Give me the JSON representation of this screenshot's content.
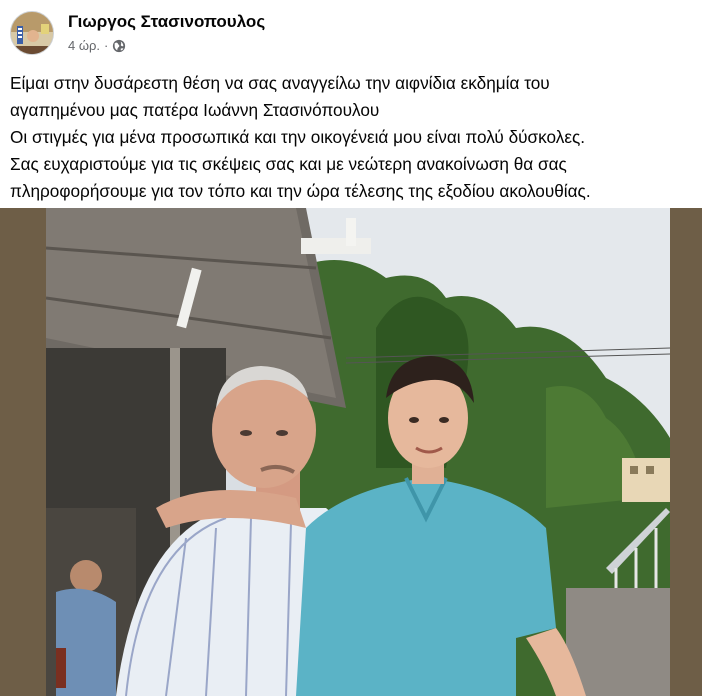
{
  "post": {
    "author": "Γιωργος Στασινοπουλος",
    "time": "4 ώρ.",
    "separator": "·",
    "privacy_icon": "globe-icon",
    "text_lines": [
      "Είμαι στην δυσάρεστη θέση να σας αναγγείλω την αιφνίδια εκδημία του",
      "αγαπημένου μας πατέρα Ιωάννη Στασινόπουλου",
      "Οι στιγμές για μένα προσωπικά και την οικογένειά μου είναι πολύ δύσκολες.",
      "Σας ευχαριστούμε για τις σκέψεις σας και με νεώτερη ανακοίνωση θα σας",
      "πληροφορήσουμε για τον τόπο και την ώρα τέλεσης της εξοδίου ακολουθίας."
    ]
  },
  "colors": {
    "name": "#050505",
    "meta": "#65676b",
    "photo_border": "#6e5e47"
  }
}
